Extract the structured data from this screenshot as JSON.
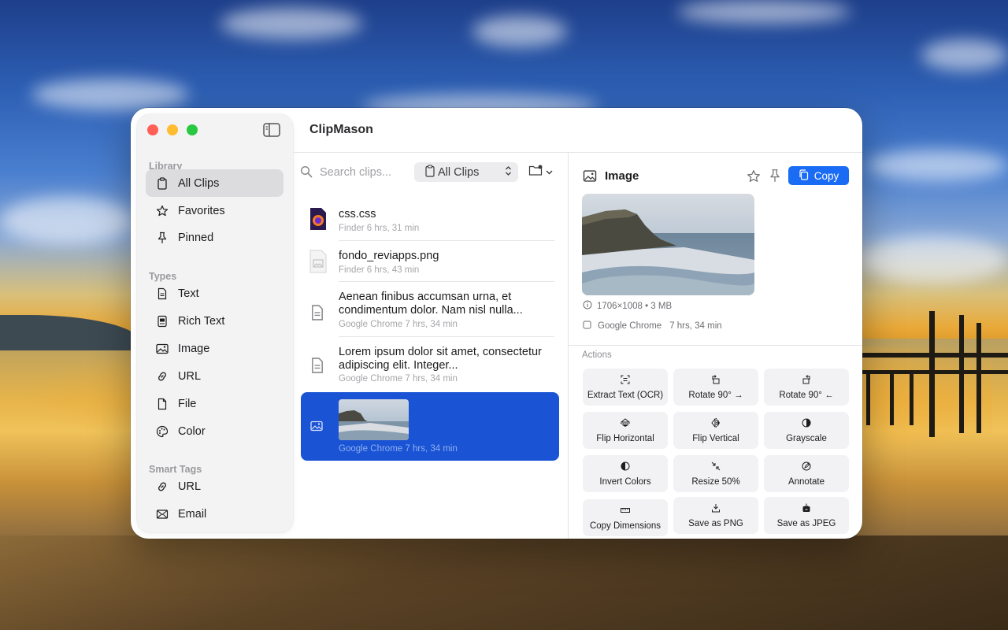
{
  "app": {
    "title": "ClipMason"
  },
  "sidebar": {
    "sections": [
      {
        "label": "Library",
        "items": [
          {
            "label": "All Clips",
            "icon": "clipboard-icon",
            "active": true
          },
          {
            "label": "Favorites",
            "icon": "star-icon"
          },
          {
            "label": "Pinned",
            "icon": "pin-icon"
          }
        ]
      },
      {
        "label": "Types",
        "items": [
          {
            "label": "Text",
            "icon": "document-text-icon"
          },
          {
            "label": "Rich Text",
            "icon": "rich-text-icon"
          },
          {
            "label": "Image",
            "icon": "photo-icon"
          },
          {
            "label": "URL",
            "icon": "link-icon"
          },
          {
            "label": "File",
            "icon": "file-icon"
          },
          {
            "label": "Color",
            "icon": "palette-icon"
          }
        ]
      },
      {
        "label": "Smart Tags",
        "items": [
          {
            "label": "URL",
            "icon": "link-icon"
          },
          {
            "label": "Email",
            "icon": "envelope-icon"
          }
        ]
      }
    ]
  },
  "list": {
    "search_placeholder": "Search clips...",
    "filter_value": "All Clips",
    "clips": [
      {
        "title": "css.css",
        "meta": "Finder   6 hrs, 31 min",
        "icon": "firefox-document-icon"
      },
      {
        "title": "fondo_reviapps.png",
        "meta": "Finder   6 hrs, 43 min",
        "icon": "image-file-icon"
      },
      {
        "title": "Aenean finibus accumsan urna, et condimentum dolor. Nam nisl nulla...",
        "meta": "Google Chrome   7 hrs, 34 min",
        "icon": "text-document-icon"
      },
      {
        "title": "Lorem ipsum dolor sit amet, consectetur adipiscing elit. Integer...",
        "meta": "Google Chrome   7 hrs, 34 min",
        "icon": "text-document-icon"
      },
      {
        "title": "",
        "meta": "Google Chrome   7 hrs, 34 min",
        "icon": "photo-icon",
        "selected": true
      }
    ]
  },
  "detail": {
    "type_label": "Image",
    "copy_label": "Copy",
    "dimensions": "1706×1008 • 3 MB",
    "source": "Google Chrome",
    "time": "7 hrs, 34 min",
    "actions_label": "Actions",
    "actions": [
      {
        "label": "Extract Text (OCR)",
        "icon": "text-scan-icon"
      },
      {
        "label": "Rotate 90° →",
        "icon": "rotate-right-icon"
      },
      {
        "label": "Rotate 90° ←",
        "icon": "rotate-left-icon"
      },
      {
        "label": "Flip Horizontal",
        "icon": "flip-horizontal-icon"
      },
      {
        "label": "Flip Vertical",
        "icon": "flip-vertical-icon"
      },
      {
        "label": "Grayscale",
        "icon": "contrast-icon"
      },
      {
        "label": "Invert Colors",
        "icon": "invert-icon"
      },
      {
        "label": "Resize 50%",
        "icon": "shrink-icon"
      },
      {
        "label": "Annotate",
        "icon": "pencil-circle-icon"
      },
      {
        "label": "Copy Dimensions",
        "icon": "ruler-icon"
      },
      {
        "label": "Save as PNG",
        "icon": "save-png-icon"
      },
      {
        "label": "Save as JPEG",
        "icon": "save-jpeg-icon"
      }
    ]
  },
  "colors": {
    "accent": "#1a6cf5",
    "selection": "#1a53d4",
    "close": "#ff5f57",
    "minimize": "#febc2e",
    "maximize": "#28c840"
  }
}
